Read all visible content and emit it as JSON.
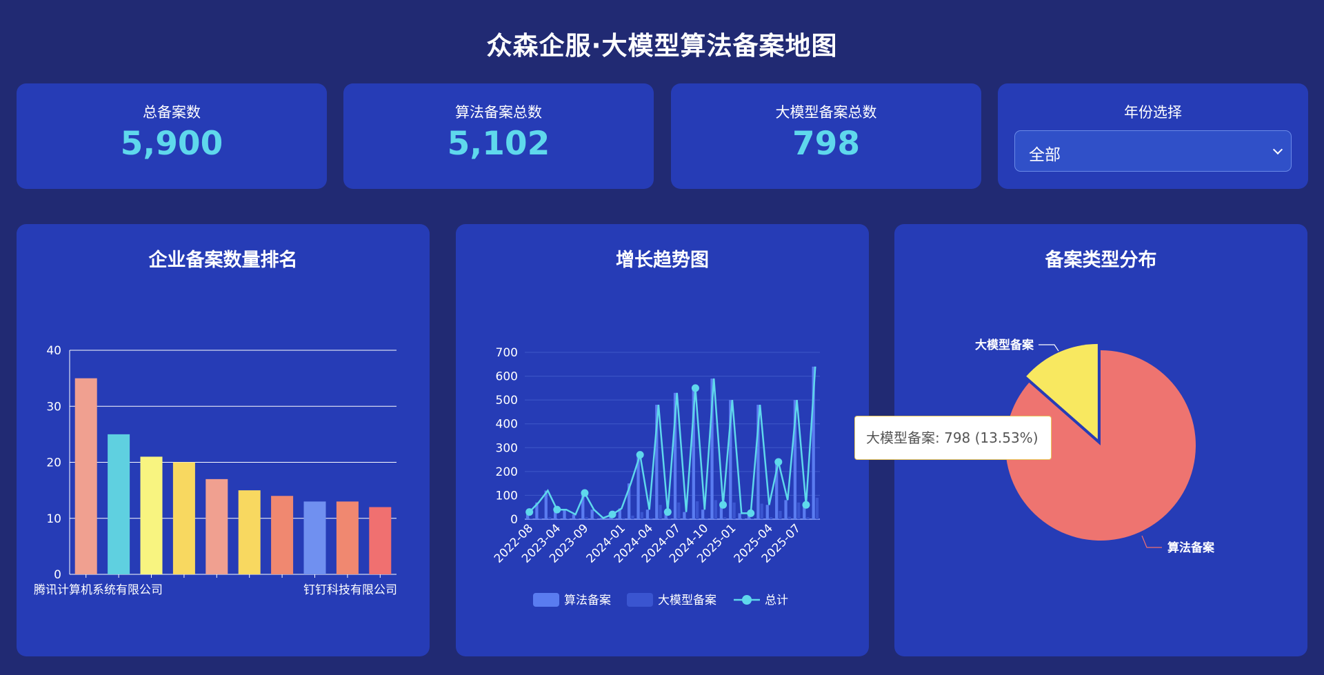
{
  "header": {
    "title": "众森企服·大模型算法备案地图"
  },
  "stats": [
    {
      "label": "总备案数",
      "value": "5,900"
    },
    {
      "label": "算法备案总数",
      "value": "5,102"
    },
    {
      "label": "大模型备案总数",
      "value": "798"
    }
  ],
  "year_filter": {
    "label": "年份选择",
    "value": "全部"
  },
  "charts": {
    "ranking_title": "企业备案数量排名",
    "trend_title": "增长趋势图",
    "type_title": "备案类型分布"
  },
  "tooltip": {
    "text": "大模型备案: 798 (13.53%)"
  },
  "colors": {
    "background": "#212a73",
    "card": "#263cb6",
    "accent": "#5fd8ec"
  },
  "chart_data": [
    {
      "type": "bar",
      "title": "企业备案数量排名",
      "x_labels_shown": [
        "腾讯计算机系统有限公司",
        "钉钉科技有限公司"
      ],
      "values": [
        35,
        25,
        21,
        20,
        17,
        15,
        14,
        13,
        13,
        12
      ],
      "colors": [
        "#f0a090",
        "#5fd0e0",
        "#f8f480",
        "#f8d860",
        "#f0a090",
        "#f8d860",
        "#f08870",
        "#7090f0",
        "#f08870",
        "#f07070"
      ],
      "yticks": [
        0,
        10,
        20,
        30,
        40
      ],
      "ylim": [
        0,
        40
      ],
      "grid": true
    },
    {
      "type": "bar+line",
      "title": "增长趋势图",
      "x_tick_labels": [
        "2022-08",
        "2023-04",
        "2023-09",
        "2024-01",
        "2024-04",
        "2024-07",
        "2024-10",
        "2025-01",
        "2025-04",
        "2025-07"
      ],
      "yticks": [
        0,
        100,
        200,
        300,
        400,
        500,
        600,
        700
      ],
      "ylim": [
        0,
        700
      ],
      "series": [
        {
          "name": "算法备案",
          "kind": "bar",
          "color": "#5a7cf0",
          "values": [
            30,
            70,
            120,
            40,
            40,
            20,
            110,
            40,
            5,
            20,
            45,
            150,
            270,
            40,
            480,
            30,
            530,
            30,
            550,
            40,
            590,
            60,
            500,
            25,
            25,
            480,
            60,
            240,
            80,
            500,
            60,
            640
          ]
        },
        {
          "name": "大模型备案",
          "kind": "bar",
          "color": "#3a55d0",
          "values": [
            2,
            5,
            8,
            3,
            3,
            2,
            8,
            3,
            0,
            2,
            5,
            15,
            30,
            5,
            60,
            4,
            70,
            4,
            75,
            5,
            80,
            8,
            70,
            3,
            3,
            65,
            8,
            35,
            10,
            70,
            8,
            90
          ]
        },
        {
          "name": "总计",
          "kind": "line",
          "color": "#5fd8ec",
          "values": [
            30,
            70,
            120,
            40,
            40,
            20,
            110,
            40,
            5,
            20,
            45,
            150,
            270,
            40,
            480,
            30,
            530,
            30,
            550,
            40,
            590,
            60,
            500,
            25,
            25,
            480,
            60,
            240,
            80,
            500,
            60,
            640
          ]
        }
      ],
      "legend": [
        "算法备案",
        "大模型备案",
        "总计"
      ],
      "legend_position": "bottom"
    },
    {
      "type": "pie",
      "title": "备案类型分布",
      "slices": [
        {
          "label": "大模型备案",
          "value": 798,
          "color": "#f8e860"
        },
        {
          "label": "算法备案",
          "value": 5102,
          "color": "#ee7470"
        }
      ]
    }
  ]
}
